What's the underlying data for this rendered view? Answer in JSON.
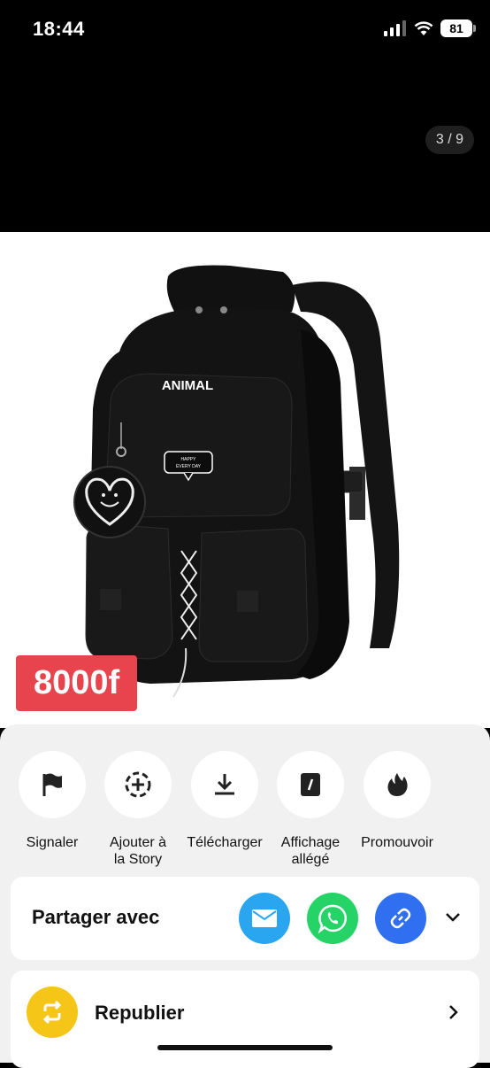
{
  "status_bar": {
    "time": "18:44",
    "battery": "81"
  },
  "gallery": {
    "counter": "3 / 9"
  },
  "product": {
    "brand_text": "ANIMAL",
    "patch_text_1": "HAPPY",
    "patch_text_2": "EVERY DAY",
    "price": "8000f"
  },
  "actions": [
    {
      "label": "Signaler",
      "icon": "flag-icon"
    },
    {
      "label": "Ajouter à\nla Story",
      "icon": "add-story-icon"
    },
    {
      "label": "Télécharger",
      "icon": "download-icon"
    },
    {
      "label": "Affichage\nallégé",
      "icon": "lite-view-icon"
    },
    {
      "label": "Promouvoir",
      "icon": "flame-icon"
    }
  ],
  "share": {
    "title": "Partager avec",
    "apps": [
      {
        "name": "mail-icon",
        "color": "#2aa6f0"
      },
      {
        "name": "whatsapp-icon",
        "color": "#25d366"
      },
      {
        "name": "link-icon",
        "color": "#2f6ff0"
      }
    ]
  },
  "republish": {
    "title": "Republier",
    "color": "#f5c518"
  }
}
